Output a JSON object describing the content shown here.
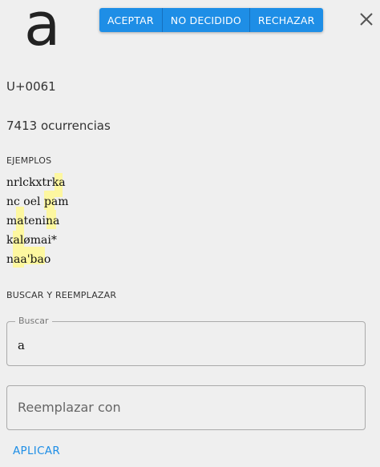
{
  "glyph": "a",
  "actions": {
    "accept": "ACEPTAR",
    "undecided": "NO DECIDIDO",
    "reject": "RECHAZAR"
  },
  "close_icon": "close-icon",
  "codepoint": "U+0061",
  "occurrences": "7413 ocurrencias",
  "examples": {
    "label": "EJEMPLOS",
    "lines": [
      "nrlckxtrka",
      "nc oel pam",
      "matenina",
      "kalømai*",
      "naa'bao"
    ],
    "highlight_color": "#fdf7a0"
  },
  "search_replace": {
    "label": "BUSCAR Y REEMPLAZAR",
    "search_label": "Buscar",
    "search_value": "a",
    "replace_placeholder": "Reemplazar con",
    "apply_label": "APLICAR"
  },
  "colors": {
    "accent": "#1e8ee6",
    "background": "#efefef"
  }
}
